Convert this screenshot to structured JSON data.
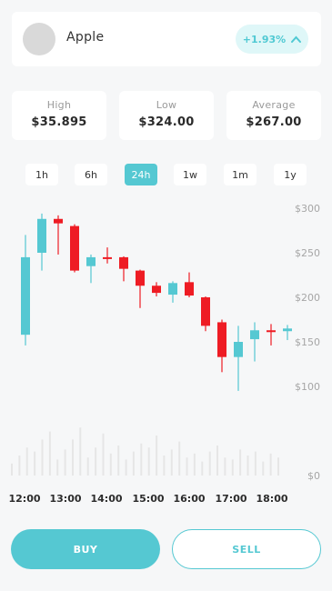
{
  "asset": {
    "name": "Apple",
    "change": "+1.93%"
  },
  "stats": [
    {
      "label": "High",
      "value": "$35.895"
    },
    {
      "label": "Low",
      "value": "$324.00"
    },
    {
      "label": "Average",
      "value": "$267.00"
    }
  ],
  "timeframes": [
    "1h",
    "6h",
    "24h",
    "1w",
    "1m",
    "1y"
  ],
  "active_timeframe": "24h",
  "actions": {
    "buy": "BUY",
    "sell": "SELL"
  },
  "colors": {
    "up": "#55c8d2",
    "down": "#ee1c24",
    "accent": "#55c8d2"
  },
  "chart_data": {
    "type": "candlestick",
    "y_axis_labels": [
      "$300",
      "$250",
      "$200",
      "$150",
      "$100",
      "$0"
    ],
    "x_axis_labels": [
      "12:00",
      "13:00",
      "14:00",
      "15:00",
      "16:00",
      "17:00",
      "18:00"
    ],
    "candles": [
      {
        "open": 158,
        "close": 245,
        "high": 270,
        "low": 146
      },
      {
        "open": 250,
        "close": 288,
        "high": 294,
        "low": 230
      },
      {
        "open": 288,
        "close": 283,
        "high": 292,
        "low": 248
      },
      {
        "open": 280,
        "close": 230,
        "high": 282,
        "low": 228
      },
      {
        "open": 235,
        "close": 245,
        "high": 248,
        "low": 216
      },
      {
        "open": 245,
        "close": 244,
        "high": 256,
        "low": 238
      },
      {
        "open": 245,
        "close": 232,
        "high": 246,
        "low": 218
      },
      {
        "open": 230,
        "close": 213,
        "high": 231,
        "low": 188
      },
      {
        "open": 213,
        "close": 205,
        "high": 217,
        "low": 201
      },
      {
        "open": 203,
        "close": 216,
        "high": 218,
        "low": 194
      },
      {
        "open": 217,
        "close": 202,
        "high": 228,
        "low": 200
      },
      {
        "open": 200,
        "close": 168,
        "high": 201,
        "low": 162
      },
      {
        "open": 172,
        "close": 133,
        "high": 175,
        "low": 116
      },
      {
        "open": 133,
        "close": 150,
        "high": 168,
        "low": 95
      },
      {
        "open": 153,
        "close": 163,
        "high": 172,
        "low": 128
      },
      {
        "open": 163,
        "close": 161,
        "high": 170,
        "low": 146
      },
      {
        "open": 162,
        "close": 165,
        "high": 169,
        "low": 152
      }
    ],
    "volumes": [
      6,
      10,
      14,
      12,
      18,
      22,
      8,
      13,
      18,
      24,
      9,
      14,
      21,
      11,
      15,
      8,
      12,
      16,
      14,
      20,
      10,
      13,
      17,
      9,
      11,
      7,
      12,
      15,
      9,
      8,
      13,
      10,
      12,
      7,
      11,
      9
    ]
  }
}
